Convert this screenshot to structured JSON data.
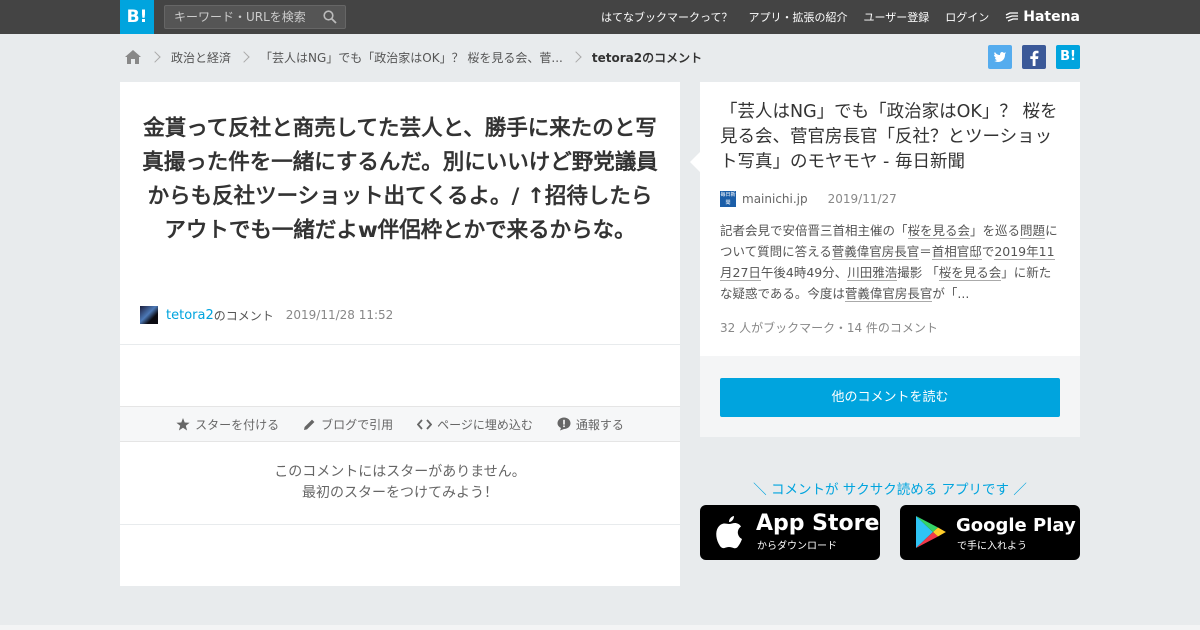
{
  "header": {
    "logo": "B!",
    "search_placeholder": "キーワード・URLを検索",
    "nav": [
      "はてなブックマークって？",
      "アプリ・拡張の紹介",
      "ユーザー登録",
      "ログイン"
    ],
    "brand": "Hatena"
  },
  "breadcrumb": {
    "items": [
      "政治と経済",
      "「芸人はNG」でも「政治家はOK」？ 桜を見る会、菅...",
      "tetora2のコメント"
    ]
  },
  "social": {
    "twitter_color": "#55acee",
    "facebook_color": "#3b5998",
    "hatebu_color": "#00a4de",
    "hatebu_label": "B!"
  },
  "comment": {
    "text": "金貰って反社と商売してた芸人と、勝手に来たのと写真撮った件を一緒にするんだ。別にいいけど野党議員からも反社ツーショット出てくるよ。/ ↑招待したらアウトでも一緒だよw伴侶枠とかで来るからな。",
    "user": "tetora2",
    "user_suffix": "のコメント",
    "date": "2019/11/28 11:52"
  },
  "actions": [
    "スターを付ける",
    "ブログで引用",
    "ページに埋め込む",
    "通報する"
  ],
  "no_stars": {
    "line1": "このコメントにはスターがありません。",
    "line2": "最初のスターをつけてみよう！"
  },
  "entry": {
    "title": "「芸人はNG」でも「政治家はOK」？ 桜を見る会、菅官房長官「反社？とツーショット写真」のモヤモヤ - 毎日新聞",
    "domain": "mainichi.jp",
    "favicon_text": "毎日新聞",
    "date": "2019/11/27",
    "summary": {
      "s1": "記者会見で安倍晋三首相主催の「",
      "k1": "桜を見る会",
      "s2": "」を巡る",
      "k2": "問題",
      "s3": "について質問に答える",
      "k3": "菅義偉官房長官",
      "s4": "＝",
      "k4": "首相官邸",
      "s5": "で",
      "k5": "2019年11月27日",
      "s6": "午後4時49分、",
      "k6": "川田雅浩",
      "s7": "撮影 「",
      "k7": "桜を見る会",
      "s8": "」に新たな疑惑である。今度は",
      "k8": "菅義偉官房長官",
      "s9": "が「..."
    },
    "counts": "32 人がブックマーク・14 件のコメント",
    "read_button": "他のコメントを読む"
  },
  "promo": {
    "text": "＼ コメントが サクサク読める アプリです ／",
    "app_store_big": "App Store",
    "app_store_small": "からダウンロード",
    "google_play_big": "Google Play",
    "google_play_small": "で手に入れよう"
  },
  "colors": {
    "accent": "#00a4de",
    "topbar": "#444444",
    "background": "#e8ebed"
  }
}
